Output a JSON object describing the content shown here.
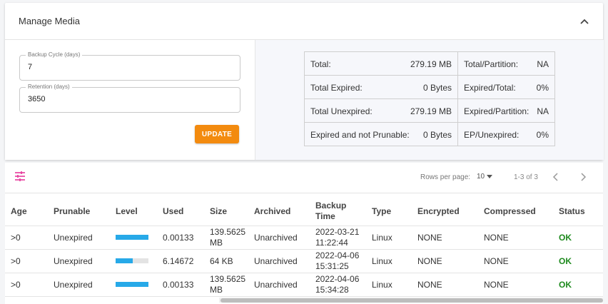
{
  "header": {
    "title": "Manage Media"
  },
  "settings": {
    "backup_cycle": {
      "label": "Backup Cycle (days)",
      "value": "7"
    },
    "retention": {
      "label": "Retention (days)",
      "value": "3650"
    },
    "update_label": "UPDATE"
  },
  "stats": [
    {
      "left_label": "Total:",
      "left_value": "279.19 MB",
      "right_label": "Total/Partition:",
      "right_value": "NA"
    },
    {
      "left_label": "Total Expired:",
      "left_value": "0 Bytes",
      "right_label": "Expired/Total:",
      "right_value": "0%"
    },
    {
      "left_label": "Total Unexpired:",
      "left_value": "279.19 MB",
      "right_label": "Expired/Partition:",
      "right_value": "NA"
    },
    {
      "left_label": "Expired and not Prunable:",
      "left_value": "0 Bytes",
      "right_label": "EP/Unexpired:",
      "right_value": "0%"
    }
  ],
  "pagination": {
    "rows_per_page_label": "Rows per page:",
    "rows_per_page_value": "10",
    "range": "1-3 of 3"
  },
  "columns": [
    "Age",
    "Prunable",
    "Level",
    "Used",
    "Size",
    "Archived",
    "Backup Time",
    "Type",
    "Encrypted",
    "Compressed",
    "Status"
  ],
  "rows": [
    {
      "age": ">0",
      "prunable": "Unexpired",
      "level": 1.0,
      "used": "0.00133",
      "size": "139.5625 MB",
      "archived": "Unarchived",
      "backup_time": "2022-03-21 11:22:44",
      "type": "Linux",
      "encrypted": "NONE",
      "compressed": "NONE",
      "status": "OK"
    },
    {
      "age": ">0",
      "prunable": "Unexpired",
      "level": 0.52,
      "used": "6.14672",
      "size": "64 KB",
      "archived": "Unarchived",
      "backup_time": "2022-04-06 15:31:25",
      "type": "Linux",
      "encrypted": "NONE",
      "compressed": "NONE",
      "status": "OK"
    },
    {
      "age": ">0",
      "prunable": "Unexpired",
      "level": 1.0,
      "used": "0.00133",
      "size": "139.5625 MB",
      "archived": "Unarchived",
      "backup_time": "2022-04-06 15:34:28",
      "type": "Linux",
      "encrypted": "NONE",
      "compressed": "NONE",
      "status": "OK"
    }
  ],
  "colors": {
    "accent": "#f38b0f",
    "level_bar": "#27a9e8",
    "status_ok": "#1d8a1d",
    "filter_icon": "#e6399b"
  },
  "icons": {
    "collapse": "chevron-up-icon",
    "filter": "tune-icon",
    "prev": "chevron-left-icon",
    "next": "chevron-right-icon"
  }
}
